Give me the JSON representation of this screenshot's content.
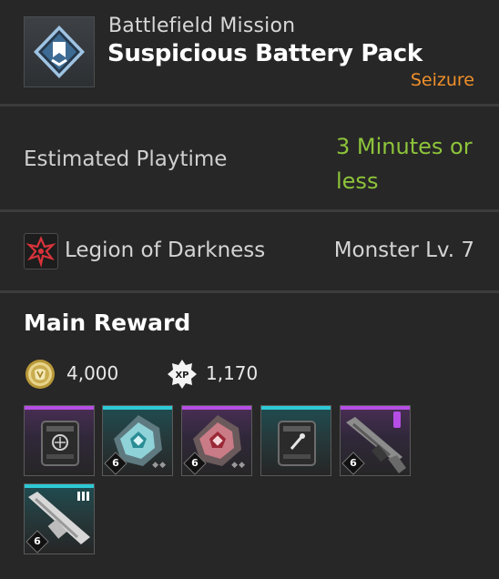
{
  "header": {
    "subtitle": "Battlefield Mission",
    "title": "Suspicious Battery Pack",
    "type_tag": "Seizure",
    "mission_icon": "chevron-rank-icon"
  },
  "playtime": {
    "label": "Estimated Playtime",
    "value_line1": "3 Minutes or",
    "value_line2": "less"
  },
  "faction": {
    "icon": "legion-emblem-icon",
    "name": "Legion of Darkness",
    "monster_level": "Monster Lv. 7"
  },
  "reward": {
    "heading": "Main Reward",
    "gold": {
      "icon": "gold-coin-icon",
      "amount": "4,000"
    },
    "xp": {
      "icon": "xp-badge-icon",
      "label": "XP",
      "amount": "1,170"
    },
    "items": [
      {
        "icon": "purple-crate-icon",
        "rarity": "purple",
        "level": ""
      },
      {
        "icon": "cyan-crystal-icon",
        "rarity": "cyan",
        "level": "6"
      },
      {
        "icon": "red-crystal-icon",
        "rarity": "purple",
        "level": "6"
      },
      {
        "icon": "cyan-crate-icon",
        "rarity": "cyan",
        "level": ""
      },
      {
        "icon": "purple-rifle-icon",
        "rarity": "purple",
        "level": "6"
      },
      {
        "icon": "white-rifle-icon",
        "rarity": "cyan",
        "level": "6"
      }
    ]
  },
  "colors": {
    "accent_orange": "#f0902a",
    "playtime_green": "#8dc43a",
    "rarity_purple": "#b64ee6",
    "rarity_cyan": "#2ec9d6"
  }
}
